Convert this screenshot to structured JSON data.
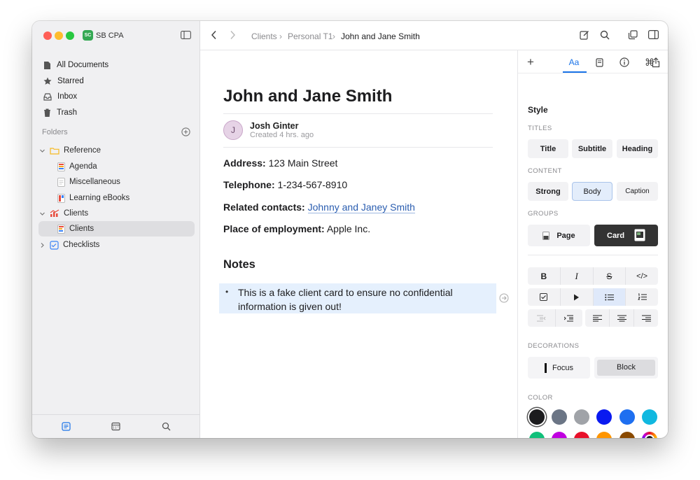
{
  "workspace": {
    "badge": "SC",
    "name": "SB CPA"
  },
  "sidebar": {
    "nav": [
      {
        "label": "All Documents",
        "icon": "document-icon"
      },
      {
        "label": "Starred",
        "icon": "star-icon"
      },
      {
        "label": "Inbox",
        "icon": "inbox-icon"
      },
      {
        "label": "Trash",
        "icon": "trash-icon"
      }
    ],
    "folders_label": "Folders",
    "tree": [
      {
        "label": "Reference",
        "icon": "folder-icon",
        "expanded": true
      },
      {
        "label": "Agenda",
        "icon": "doc-color-icon"
      },
      {
        "label": "Miscellaneous",
        "icon": "doc-plain-icon"
      },
      {
        "label": "Learning eBooks",
        "icon": "doc-color-icon"
      },
      {
        "label": "Clients",
        "icon": "chart-folder-icon",
        "expanded": true
      },
      {
        "label": "Clients",
        "icon": "doc-color-icon",
        "selected": true
      },
      {
        "label": "Checklists",
        "icon": "checklist-icon",
        "expanded": false
      }
    ]
  },
  "breadcrumb": {
    "items": [
      "Clients",
      "Personal T1"
    ],
    "current": "John and Jane Smith"
  },
  "document": {
    "title": "John and Jane Smith",
    "author_initial": "J",
    "author": "Josh Ginter",
    "created": "Created 4 hrs. ago",
    "fields": [
      {
        "label": "Address:",
        "value": "123 Main Street"
      },
      {
        "label": "Telephone:",
        "value": "1-234-567-8910"
      },
      {
        "label": "Related contacts:",
        "value": "Johnny and Janey Smith"
      },
      {
        "label": "Place of employment:",
        "value": "Apple Inc."
      }
    ],
    "notes_heading": "Notes",
    "note_bullet": "•",
    "note_text": "This is a fake client card to ensure no confidential information is given out!"
  },
  "panel": {
    "tabs": [
      "+",
      "Aa",
      "bookmark-icon",
      "info-icon",
      "command-icon",
      "share-icon"
    ],
    "style_heading": "Style",
    "titles_label": "TITLES",
    "titles": [
      "Title",
      "Subtitle",
      "Heading"
    ],
    "content_label": "CONTENT",
    "content": [
      "Strong",
      "Body",
      "Caption"
    ],
    "groups_label": "GROUPS",
    "groups": [
      "Page",
      "Card"
    ],
    "format_row1": [
      "B",
      "I",
      "S",
      "</>"
    ],
    "decorations_label": "DECORATIONS",
    "decorations": [
      "Focus",
      "Block"
    ],
    "color_label": "COLOR",
    "colors": [
      "#1c1c1e",
      "#6b7585",
      "#a0a3a8",
      "#0a1af0",
      "#1e6ff0",
      "#10b8e0",
      "#10c07a",
      "#c000e0",
      "#e8102a",
      "#ff9500",
      "#8a4a00",
      "#multicolor"
    ]
  }
}
